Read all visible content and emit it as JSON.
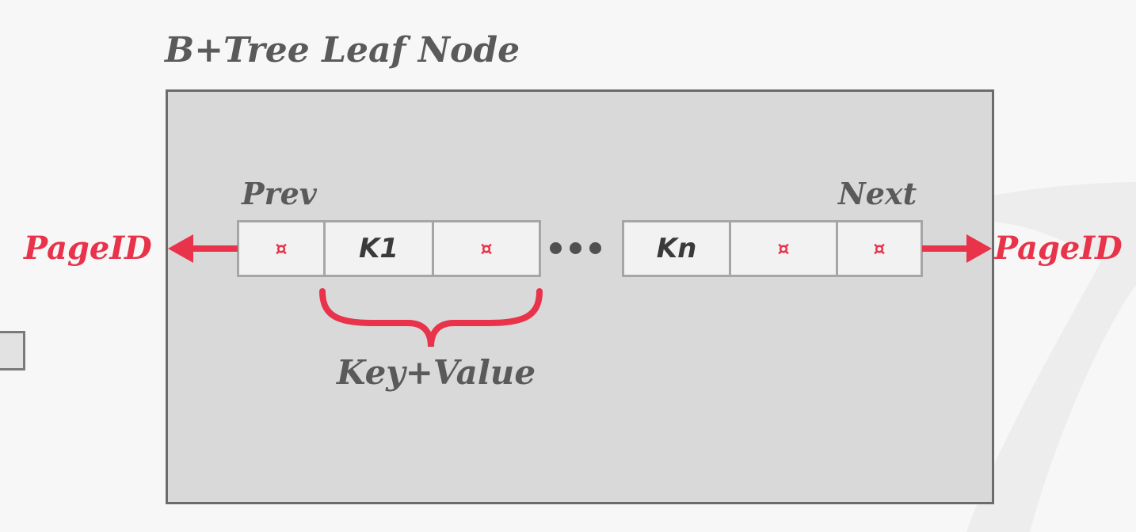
{
  "title": "B+Tree Leaf Node",
  "labels": {
    "prev": "Prev",
    "next": "Next",
    "page_id_left": "PageID",
    "page_id_right": "PageID",
    "key_value": "Key+Value"
  },
  "cells": {
    "k1": "K1",
    "kn": "Kn",
    "pointer_glyph": "¤"
  },
  "colors": {
    "accent_red": "#e8334a",
    "node_fill": "#d9d9d9",
    "cell_fill": "#f2f2f2",
    "text_gray": "#5a5a5a"
  }
}
